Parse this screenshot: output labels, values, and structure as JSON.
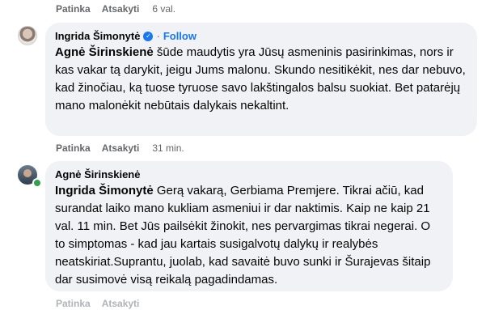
{
  "top_actions": {
    "like": "Patinka",
    "reply": "Atsakyti",
    "time": "6 val."
  },
  "comment1": {
    "author": "Ingrida Šimonytė",
    "separator": "·",
    "follow": "Follow",
    "mention": "Agnė Širinskienė",
    "text": "šūde maudytis yra Jūsų asmeninis pasirinkimas, nors ir kas vakar tą darykit, jeigu Jums malonu. Skundo nesitikėkit, nes dar nebuvo, kad žinočiau, ką tuose tyruose savo lakštingalos balsu suokiat. Bet patarėjų mano malonėkit nebūtais dalykais nekaltint.",
    "actions": {
      "like": "Patinka",
      "reply": "Atsakyti",
      "time": "31 min."
    }
  },
  "comment2": {
    "author": "Agnė Širinskienė",
    "mention": "Ingrida Šimonytė",
    "text": "Gerą vakarą, Gerbiama Premjere. Tikrai ačiū, kad surandat laiko mano kukliam asmeniui ir dar naktimis. Kaip ne kaip 21 val. 11 min. Bet Jūs pailsėkit žinokit, nes pervargimas tikrai negerai. O to simptomas - kad jau kartais susigalvotų dalykų ir realybės neatskiriat.Suprantu, juolab, kad savaitė buvo sunki ir Šurajevas šitaip dar susimovė visą reikalą pagadindamas.",
    "actions": {
      "like": "Patinka",
      "reply": "Atsakyti"
    }
  },
  "colors": {
    "link": "#1877f2",
    "bubble": "#f0f2f5",
    "meta": "#65676b",
    "online": "#31a24c"
  }
}
